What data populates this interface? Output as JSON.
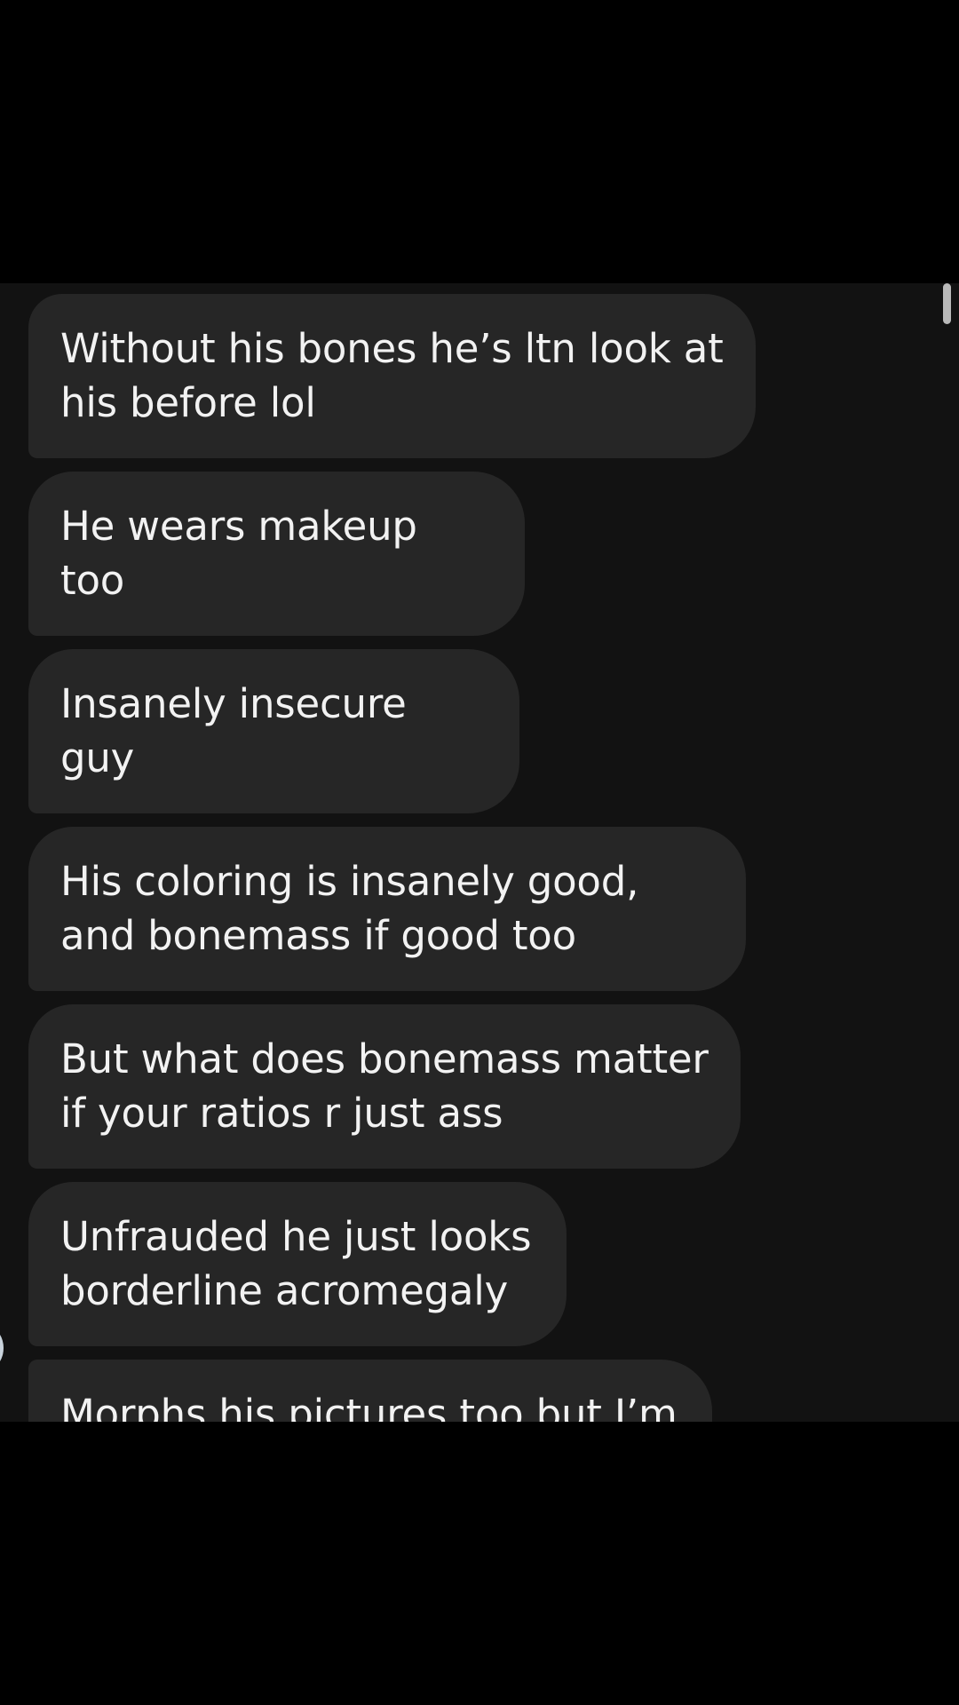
{
  "colors": {
    "screen_background": "#000000",
    "chat_background": "#121212",
    "bubble_background": "#262626",
    "bubble_text": "#f2f2f2",
    "scrollbar": "#b9b9b9"
  },
  "messages": [
    {
      "text": "Without his bones he’s ltn look at his before lol"
    },
    {
      "text": "He wears makeup too"
    },
    {
      "text": "Insanely insecure guy"
    },
    {
      "text": "His coloring is insanely good, and bonemass if good too"
    },
    {
      "text": "But what does bonemass matter if your ratios r just ass"
    },
    {
      "text": "Unfrauded he just looks borderline acromegaly"
    },
    {
      "text": "Morphs his pictures too but I’m sure you knew that"
    }
  ]
}
